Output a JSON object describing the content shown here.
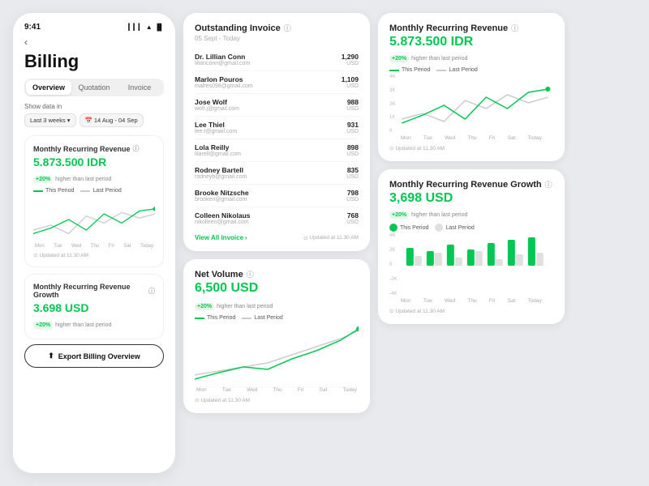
{
  "phone": {
    "time": "9:41",
    "back": "‹",
    "title": "Billing",
    "tabs": [
      "Overview",
      "Quotation",
      "Invoice"
    ],
    "active_tab": "Overview",
    "show_data_label": "Show data in",
    "filter1": "Last 3 weeks",
    "filter2": "14 Aug - 04 Sep",
    "card1": {
      "title": "Monthly Recurring Revenue",
      "amount": "5.873.500 IDR",
      "badge": "+20%",
      "badge_text": "higher than last period",
      "legend1": "This Period",
      "legend2": "Last Period",
      "updated": "Updated at 11.30 AM"
    },
    "card2": {
      "title": "Monthly Recurring Revenue Growth",
      "amount": "3.698 USD",
      "badge": "+20%",
      "badge_text": "higher than last period"
    },
    "export_btn": "Export Billing Overview"
  },
  "outstanding": {
    "title": "Outstanding Invoice",
    "date": "05 Sept - Today",
    "invoices": [
      {
        "name": "Dr. Lillian Conn",
        "email": "lilianconn@gmail.com",
        "amount": "1,290",
        "currency": "USD"
      },
      {
        "name": "Marlon Pouros",
        "email": "malres098@gmail.com",
        "amount": "1,109",
        "currency": "USD"
      },
      {
        "name": "Jose Wolf",
        "email": "wolf.j@gmail.com",
        "amount": "988",
        "currency": "USD"
      },
      {
        "name": "Lee Thiel",
        "email": "lee.t@gmail.com",
        "amount": "931",
        "currency": "USD"
      },
      {
        "name": "Lola Reilly",
        "email": "lilarell@gmail.com",
        "amount": "898",
        "currency": "USD"
      },
      {
        "name": "Rodney Bartell",
        "email": "rodneyb@gmail.com",
        "amount": "835",
        "currency": "USD"
      },
      {
        "name": "Brooke Nitzsche",
        "email": "brooken@gmail.com",
        "amount": "798",
        "currency": "USD"
      },
      {
        "name": "Colleen Nikolaus",
        "email": "nikolleen@gmail.com",
        "amount": "768",
        "currency": "USD"
      }
    ],
    "view_all": "View All Invoice",
    "updated": "Updated at 11.30 AM"
  },
  "net_volume": {
    "title": "Net Volume",
    "amount": "6,500 USD",
    "badge": "+20%",
    "badge_text": "higher than last period",
    "legend1": "This Period",
    "legend2": "Last Period",
    "x_labels": [
      "Mon",
      "Tue",
      "Wed",
      "Thu",
      "Fri",
      "Sat",
      "Today"
    ],
    "updated": "Updated at 11.30 AM"
  },
  "mrr": {
    "title": "Monthly Recurring Revenue",
    "amount": "5.873.500 IDR",
    "badge": "+20%",
    "badge_text": "higher than last period",
    "legend1": "This Period",
    "legend2": "Last Period",
    "y_labels": [
      "4K",
      "3K",
      "2K",
      "1K",
      "0"
    ],
    "x_labels": [
      "Mon",
      "Tue",
      "Wed",
      "Thu",
      "Fri",
      "Sat",
      "Today"
    ],
    "updated": "Updated at 11.30 AM"
  },
  "mrr_growth": {
    "title": "Monthly Recurring Revenue Growth",
    "amount": "3,698 USD",
    "badge": "+20%",
    "badge_text": "higher than last period",
    "legend1": "This Period",
    "legend2": "Last Period",
    "y_labels": [
      "4K",
      "2K",
      "0",
      "-2K",
      "-4K"
    ],
    "x_labels": [
      "Mon",
      "Tue",
      "Wed",
      "Thu",
      "Fri",
      "Sat",
      "Today"
    ],
    "updated": "Updated at 11.30 AM",
    "bars": {
      "this_period": [
        55,
        45,
        60,
        50,
        65,
        70,
        75
      ],
      "last_period": [
        40,
        50,
        35,
        45,
        38,
        42,
        48
      ]
    }
  },
  "info_icon": "ⓘ",
  "clock_icon": "⊙",
  "chevron": "›"
}
